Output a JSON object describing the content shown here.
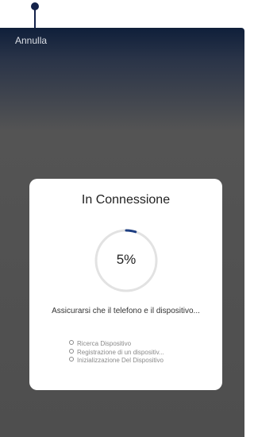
{
  "header": {
    "cancel_label": "Annulla"
  },
  "dialog": {
    "title": "In Connessione",
    "progress": {
      "value_percent": 5,
      "label": "5%",
      "track_color": "#e2e2e2",
      "fill_color": "#1f3f82"
    },
    "message": "Assicurarsi che il telefono e il dispositivo...",
    "steps": [
      "Ricerca Dispositivo",
      "Registrazione di un dispositiv...",
      "Inizializzazione Del Dispositivo"
    ]
  },
  "colors": {
    "pointer": "#14224a",
    "background_top": "#0f1f3a",
    "background_bottom": "#4e4e4e",
    "dialog_background": "#ffffff"
  }
}
